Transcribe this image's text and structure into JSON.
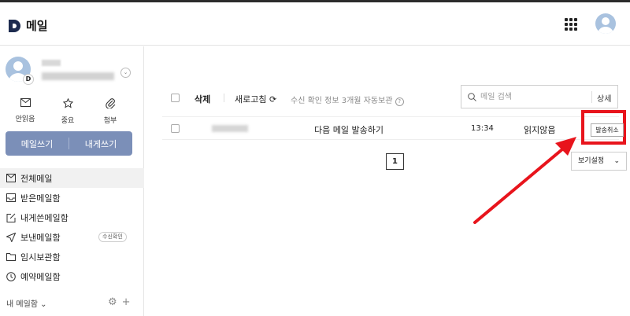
{
  "header": {
    "app_title": "메일",
    "logo_letter": "D"
  },
  "profile": {
    "badge_letter": "D"
  },
  "quick_actions": [
    {
      "label": "안읽음",
      "icon": "envelope-icon"
    },
    {
      "label": "중요",
      "icon": "star-icon"
    },
    {
      "label": "첨부",
      "icon": "paperclip-icon"
    }
  ],
  "compose": {
    "write_label": "메일쓰기",
    "self_label": "내게쓰기"
  },
  "nav": {
    "items": [
      {
        "label": "전체메일",
        "icon": "mailbox-icon"
      },
      {
        "label": "받은메일함",
        "icon": "inbox-icon"
      },
      {
        "label": "내게쓴메일함",
        "icon": "edit-box-icon"
      },
      {
        "label": "보낸메일함",
        "icon": "send-icon",
        "badge": "수신확인"
      },
      {
        "label": "임시보관함",
        "icon": "folder-icon"
      },
      {
        "label": "예약메일함",
        "icon": "clock-icon"
      }
    ],
    "my_mail_label": "내 메일함"
  },
  "toolbar": {
    "delete_label": "삭제",
    "refresh_label": "새로고침",
    "info_text": "수신 확인 정보 3개월 자동보관"
  },
  "search": {
    "placeholder": "메일 검색",
    "detail_label": "상세"
  },
  "mail_rows": [
    {
      "subject": "다음 메일 발송하기",
      "time": "13:34",
      "status": "읽지않음",
      "action_label": "발송취소"
    }
  ],
  "pagination": {
    "current_page": "1"
  },
  "view_settings": {
    "label": "보기설정"
  },
  "colors": {
    "compose_bar": "#7b8fb8",
    "highlight": "#e8141c"
  }
}
